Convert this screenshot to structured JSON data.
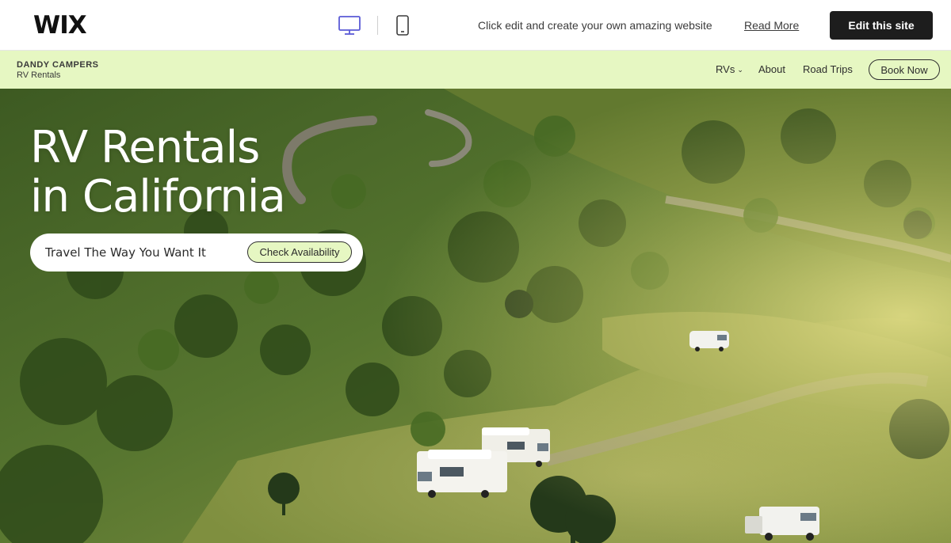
{
  "wix_bar": {
    "logo": "WIX",
    "message": "Click edit and create your own amazing website",
    "read_more": "Read More",
    "edit_button": "Edit this site",
    "devices": [
      "desktop-icon",
      "mobile-icon"
    ]
  },
  "header": {
    "brand_name": "DANDY CAMPERS",
    "brand_sub": "RV Rentals",
    "nav": [
      {
        "label": "RVs",
        "icon": "chevron-down-icon"
      },
      {
        "label": "About"
      },
      {
        "label": "Road Trips"
      }
    ],
    "cta": "Book Now",
    "background": "#e6f7c2"
  },
  "hero": {
    "title_line1": "RV Rentals",
    "title_line2": "in California",
    "tagline": "Travel The Way You Want It",
    "cta": "Check Availability",
    "image": "hillside-rv-campground-photo"
  },
  "colors": {
    "accent": "#e6f7c2",
    "dark": "#1d1d1d"
  }
}
